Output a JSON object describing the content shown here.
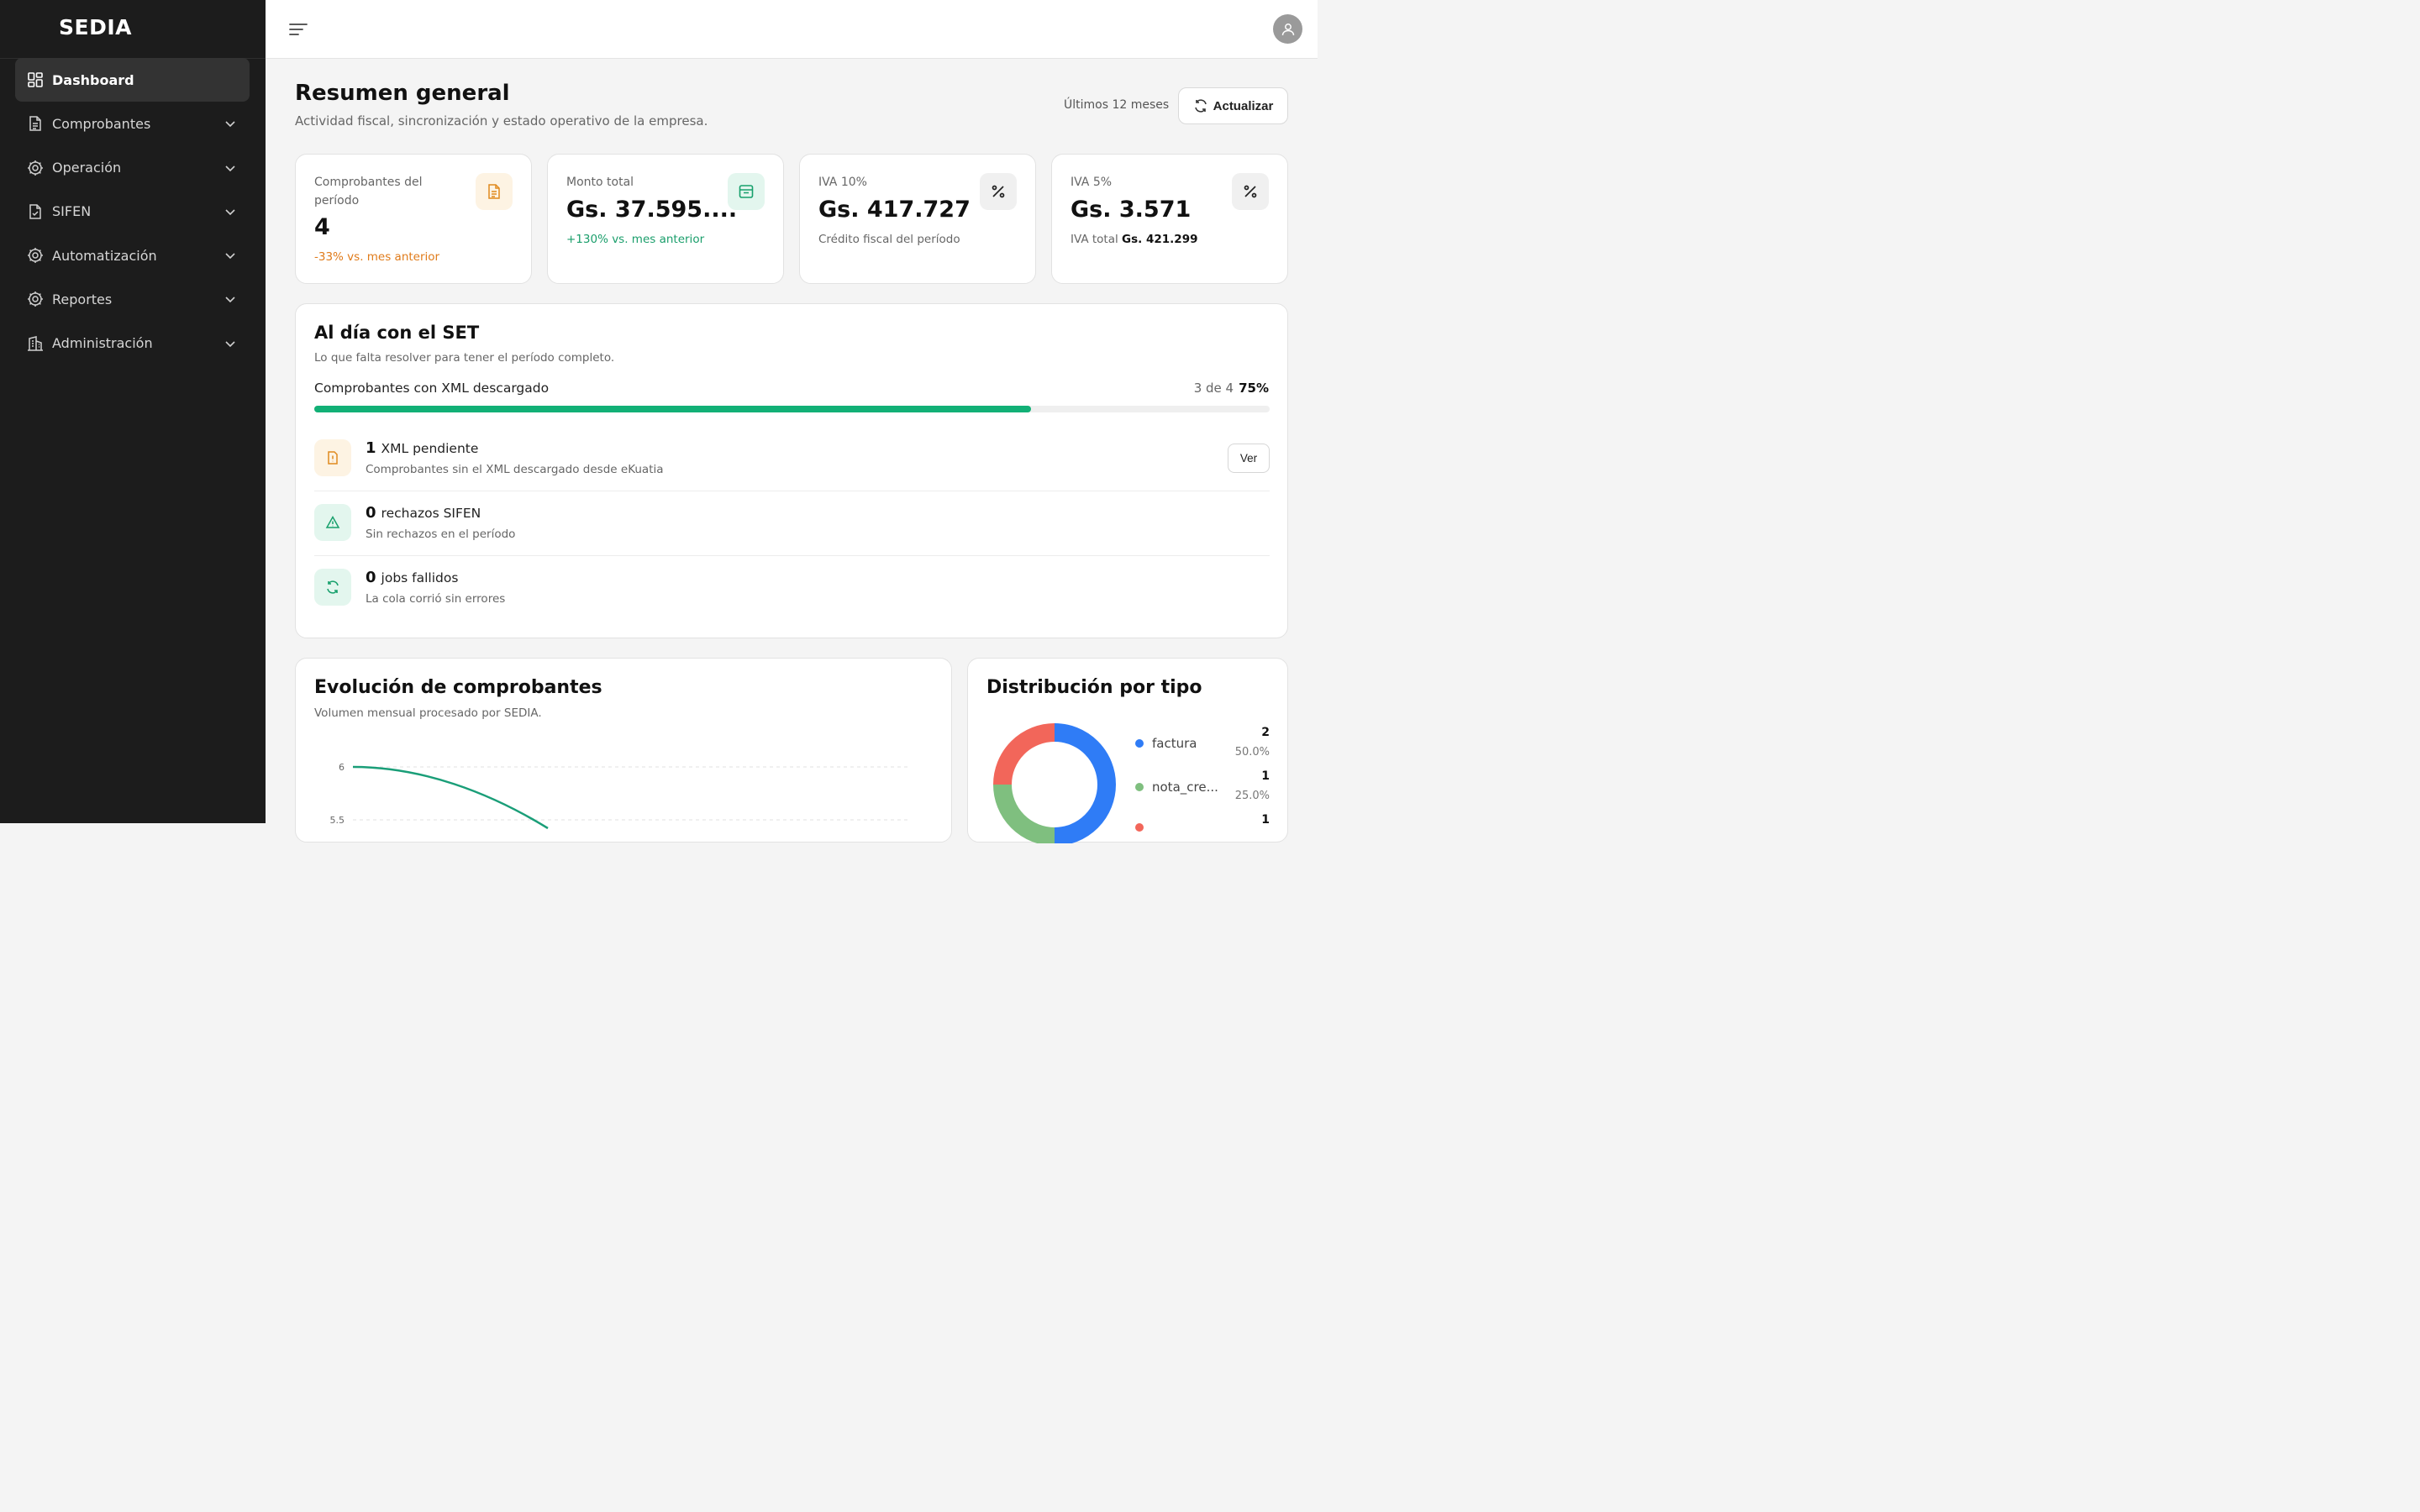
{
  "brand": "SEDIA",
  "nav": [
    {
      "label": "Dashboard",
      "icon": "dashboard-grid-icon",
      "active": true
    },
    {
      "label": "Comprobantes",
      "icon": "document-icon"
    },
    {
      "label": "Operación",
      "icon": "gear-icon"
    },
    {
      "label": "SIFEN",
      "icon": "document-check-icon"
    },
    {
      "label": "Automatización",
      "icon": "gear-icon"
    },
    {
      "label": "Reportes",
      "icon": "gear-icon"
    },
    {
      "label": "Administración",
      "icon": "building-icon"
    }
  ],
  "header": {
    "title": "Resumen general",
    "subtitle": "Actividad fiscal, sincronización y estado operativo de la empresa.",
    "range": "Últimos 12 meses",
    "refresh_label": "Actualizar"
  },
  "kpis": [
    {
      "label_line1": "Comprobantes del",
      "label_line2": "período",
      "value": "4",
      "foot": "-33% vs. mes anterior",
      "foot_color": "#e07b1a",
      "icon": "document-icon",
      "icon_bg": "#fdf3e3",
      "icon_color": "#e08a1e"
    },
    {
      "label_line1": "Monto total",
      "value": "Gs. 37.595....",
      "foot": "+130% vs. mes anterior",
      "foot_color": "#1a9e6b",
      "icon": "inbox-icon",
      "icon_bg": "#e3f6ee",
      "icon_color": "#17a06c"
    },
    {
      "label_line1": "IVA 10%",
      "value": "Gs. 417.727",
      "foot": "Crédito fiscal del período",
      "foot_color": "#666666",
      "icon": "percent-icon",
      "icon_bg": "#f0f0f0",
      "icon_color": "#222222"
    },
    {
      "label_line1": "IVA 5%",
      "value": "Gs. 3.571",
      "foot_prefix": "IVA total",
      "foot_bold": "Gs. 421.299",
      "foot_color": "#666666",
      "icon": "percent-icon",
      "icon_bg": "#f0f0f0",
      "icon_color": "#222222"
    }
  ],
  "status": {
    "title": "Al día con el SET",
    "subtitle": "Lo que falta resolver para tener el período completo.",
    "progress_label": "Comprobantes con XML descargado",
    "progress_count": "3 de 4",
    "progress_pct": "75%",
    "progress_value": 0.75,
    "items": [
      {
        "num": "1",
        "label": "XML pendiente",
        "sub": "Comprobantes sin el XML descargado desde eKuatia",
        "icon": "alert-file-icon",
        "icon_bg": "#fdf3e3",
        "icon_color": "#e08a1e",
        "action": "Ver"
      },
      {
        "num": "0",
        "label": "rechazos SIFEN",
        "sub": "Sin rechazos en el período",
        "icon": "warning-triangle-icon",
        "icon_bg": "#e3f6ee",
        "icon_color": "#17a06c"
      },
      {
        "num": "0",
        "label": "jobs fallidos",
        "sub": "La cola corrió sin errores",
        "icon": "refresh-icon",
        "icon_bg": "#e3f6ee",
        "icon_color": "#17a06c"
      }
    ]
  },
  "evolution": {
    "title": "Evolución de comprobantes",
    "subtitle": "Volumen mensual procesado por SEDIA."
  },
  "distribution": {
    "title": "Distribución por tipo",
    "legend": [
      {
        "name": "factura",
        "count": "2",
        "pct": "50.0%",
        "color": "#2f7cf6"
      },
      {
        "name": "nota_cre...",
        "count": "1",
        "pct": "25.0%",
        "color": "#7fbf7f"
      },
      {
        "name": "",
        "count": "1",
        "pct": "",
        "color": "#f2665a"
      }
    ]
  },
  "chart_data": [
    {
      "type": "line",
      "title": "Evolución de comprobantes",
      "y_ticks": [
        "6",
        "5.5"
      ],
      "series": [
        {
          "values": [
            6,
            5.5
          ]
        }
      ]
    },
    {
      "type": "pie",
      "title": "Distribución por tipo",
      "categories": [
        "factura",
        "nota_cre...",
        ""
      ],
      "values": [
        2,
        1,
        1
      ],
      "percent": [
        "50.0%",
        "25.0%",
        ""
      ],
      "colors": [
        "#2f7cf6",
        "#7fbf7f",
        "#f2665a"
      ]
    }
  ]
}
